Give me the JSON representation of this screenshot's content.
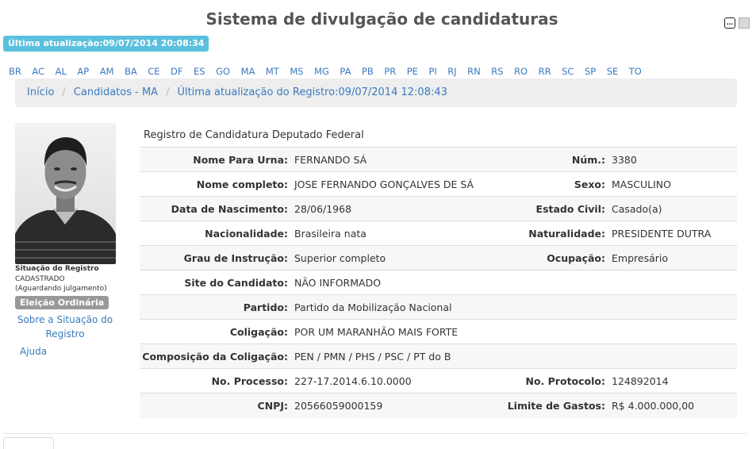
{
  "header": {
    "title": "Sistema de divulgação de candidaturas"
  },
  "update_badge": "Última atualização:09/07/2014 20:08:34",
  "states": [
    "BR",
    "AC",
    "AL",
    "AP",
    "AM",
    "BA",
    "CE",
    "DF",
    "ES",
    "GO",
    "MA",
    "MT",
    "MS",
    "MG",
    "PA",
    "PB",
    "PR",
    "PE",
    "PI",
    "RJ",
    "RN",
    "RS",
    "RO",
    "RR",
    "SC",
    "SP",
    "SE",
    "TO"
  ],
  "breadcrumb": {
    "home": "Início",
    "candidates": "Candidatos - MA",
    "last_update": "Última atualização do Registro:09/07/2014 12:08:43"
  },
  "left": {
    "situacao_label": "Situação do Registro",
    "situacao_value": "CADASTRADO",
    "situacao_note": "(Aguardando julgamento)",
    "eleicao_badge": "Eleição Ordinária",
    "sobre_link": "Sobre a Situação do Registro",
    "ajuda_link": "Ajuda"
  },
  "registro_title": "Registro de Candidatura Deputado Federal",
  "fields": {
    "nome_urna_label": "Nome Para Urna:",
    "nome_urna": "FERNANDO SÁ",
    "num_label": "Núm.:",
    "num": "3380",
    "nome_completo_label": "Nome completo:",
    "nome_completo": "JOSE FERNANDO GONÇALVES DE SÁ",
    "sexo_label": "Sexo:",
    "sexo": "MASCULINO",
    "nascimento_label": "Data de Nascimento:",
    "nascimento": "28/06/1968",
    "estado_civil_label": "Estado Civil:",
    "estado_civil": "Casado(a)",
    "nacionalidade_label": "Nacionalidade:",
    "nacionalidade": "Brasileira nata",
    "naturalidade_label": "Naturalidade:",
    "naturalidade": "PRESIDENTE DUTRA",
    "instrucao_label": "Grau de Instrução:",
    "instrucao": "Superior completo",
    "ocupacao_label": "Ocupação:",
    "ocupacao": "Empresário",
    "site_label": "Site do Candidato:",
    "site": "NÃO INFORMADO",
    "partido_label": "Partido:",
    "partido": "Partido da Mobilização Nacional",
    "coligacao_label": "Coligação:",
    "coligacao": "POR UM MARANHÃO MAIS FORTE",
    "composicao_label": "Composição da Coligação:",
    "composicao": "PEN / PMN / PHS / PSC / PT do B",
    "processo_label": "No. Processo:",
    "processo": "227-17.2014.6.10.0000",
    "protocolo_label": "No. Protocolo:",
    "protocolo": "124892014",
    "cnpj_label": "CNPJ:",
    "cnpj": "20566059000159",
    "limite_label": "Limite de Gastos:",
    "limite": "R$ 4.000.000,00"
  },
  "icons": {
    "top_left": "chat-icon",
    "top_right": "print-icon"
  },
  "colors": {
    "link": "#3a7abf",
    "badge_info": "#5bc0de",
    "badge_gray": "#999999"
  }
}
